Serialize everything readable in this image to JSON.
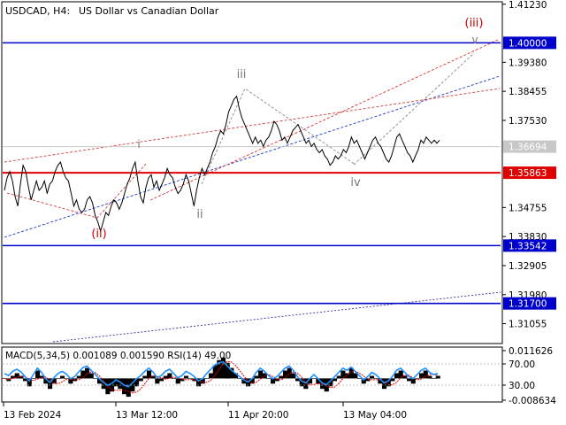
{
  "header": {
    "symbol": "USDCAD, H4:",
    "description": "US Dollar vs Canadian Dollar"
  },
  "chart_data": {
    "type": "line",
    "title": "USDCAD, H4:  US Dollar vs Canadian Dollar",
    "xlabel": "",
    "ylabel": "",
    "ylim": [
      1.3045,
      1.4128
    ],
    "grid": false,
    "price_ticks": [
      "1.41230",
      "1.39380",
      "1.38455",
      "1.37530",
      "1.34755",
      "1.33830",
      "1.32905",
      "1.31980",
      "1.31055"
    ],
    "x_ticks": [
      "13 Feb 2024",
      "13 Mar 12:00",
      "11 Apr 20:00",
      "13 May 04:00"
    ],
    "levels": [
      {
        "value": 1.4,
        "label": "1.40000",
        "color": "#0000cc"
      },
      {
        "value": 1.35863,
        "label": "1.35863",
        "color": "#e00000"
      },
      {
        "value": 1.33542,
        "label": "1.33542",
        "color": "#0000cc"
      },
      {
        "value": 1.317,
        "label": "1.31700",
        "color": "#0000cc"
      }
    ],
    "current_price": {
      "value": 1.36694,
      "label": "1.36694"
    },
    "price_series": {
      "name": "USDCAD",
      "values": [
        1.353,
        1.357,
        1.359,
        1.356,
        1.351,
        1.348,
        1.355,
        1.361,
        1.359,
        1.354,
        1.35,
        1.353,
        1.356,
        1.353,
        1.354,
        1.356,
        1.352,
        1.355,
        1.356,
        1.359,
        1.361,
        1.362,
        1.359,
        1.357,
        1.356,
        1.352,
        1.348,
        1.35,
        1.347,
        1.346,
        1.347,
        1.35,
        1.351,
        1.349,
        1.345,
        1.343,
        1.34,
        1.343,
        1.346,
        1.345,
        1.348,
        1.35,
        1.349,
        1.347,
        1.349,
        1.352,
        1.355,
        1.357,
        1.36,
        1.362,
        1.356,
        1.351,
        1.349,
        1.354,
        1.357,
        1.358,
        1.354,
        1.356,
        1.353,
        1.355,
        1.357,
        1.36,
        1.358,
        1.357,
        1.354,
        1.352,
        1.353,
        1.355,
        1.358,
        1.356,
        1.352,
        1.348,
        1.353,
        1.357,
        1.36,
        1.358,
        1.36,
        1.362,
        1.365,
        1.367,
        1.37,
        1.372,
        1.371,
        1.374,
        1.378,
        1.38,
        1.382,
        1.383,
        1.379,
        1.376,
        1.374,
        1.372,
        1.37,
        1.368,
        1.37,
        1.368,
        1.369,
        1.367,
        1.369,
        1.37,
        1.372,
        1.375,
        1.374,
        1.372,
        1.369,
        1.37,
        1.368,
        1.37,
        1.372,
        1.373,
        1.374,
        1.372,
        1.37,
        1.368,
        1.369,
        1.367,
        1.368,
        1.366,
        1.365,
        1.366,
        1.364,
        1.363,
        1.361,
        1.362,
        1.364,
        1.363,
        1.364,
        1.366,
        1.365,
        1.367,
        1.37,
        1.368,
        1.369,
        1.367,
        1.365,
        1.363,
        1.365,
        1.367,
        1.369,
        1.37,
        1.368,
        1.367,
        1.365,
        1.363,
        1.362,
        1.364,
        1.367,
        1.37,
        1.371,
        1.369,
        1.367,
        1.365,
        1.364,
        1.362,
        1.364,
        1.366,
        1.369,
        1.368,
        1.37,
        1.369,
        1.368,
        1.369,
        1.368,
        1.369
      ]
    },
    "waves": [
      {
        "label": "i",
        "color": "#777777"
      },
      {
        "label": "(ii)",
        "color": "#cc0000"
      },
      {
        "label": "ii",
        "color": "#777777"
      },
      {
        "label": "iii",
        "color": "#777777"
      },
      {
        "label": "iv",
        "color": "#777777"
      },
      {
        "label": "(iii)",
        "color": "#cc0000"
      },
      {
        "label": "v",
        "color": "#777777"
      }
    ],
    "indicator": {
      "label": "MACD(5,34,5) 0.001089 0.001590 RSI(14) 49.00",
      "ticks": [
        "0.011626",
        "70.00",
        "30.00",
        "-0.008634"
      ],
      "macd_values": [
        0.0,
        -0.001,
        0.001,
        0.002,
        0.001,
        -0.001,
        -0.003,
        0.0,
        0.003,
        0.001,
        -0.002,
        -0.004,
        -0.002,
        0.0,
        0.001,
        0.0,
        -0.002,
        -0.001,
        0.001,
        0.003,
        0.004,
        0.002,
        0.0,
        -0.002,
        -0.004,
        -0.006,
        -0.005,
        -0.003,
        -0.004,
        -0.006,
        -0.007,
        -0.005,
        -0.003,
        -0.001,
        0.001,
        0.003,
        0.001,
        -0.002,
        -0.001,
        0.001,
        0.002,
        0.0,
        -0.002,
        -0.001,
        0.001,
        0.0,
        -0.001,
        -0.003,
        -0.002,
        0.0,
        0.002,
        0.005,
        0.007,
        0.008,
        0.006,
        0.004,
        0.002,
        0.0,
        -0.002,
        -0.003,
        -0.002,
        0.001,
        0.003,
        0.002,
        0.0,
        -0.002,
        -0.001,
        0.001,
        0.003,
        0.004,
        0.002,
        -0.001,
        -0.003,
        -0.004,
        -0.002,
        0.0,
        -0.002,
        -0.004,
        -0.005,
        -0.003,
        -0.001,
        0.001,
        0.003,
        0.002,
        0.004,
        0.002,
        0.0,
        -0.002,
        -0.001,
        0.001,
        0.0,
        -0.002,
        -0.004,
        -0.003,
        -0.001,
        0.002,
        0.003,
        0.001,
        -0.001,
        -0.002,
        0.0,
        0.002,
        0.003,
        0.001,
        0.0,
        0.001
      ],
      "rsi_values": [
        52,
        48,
        56,
        60,
        55,
        46,
        38,
        50,
        62,
        54,
        42,
        35,
        44,
        52,
        56,
        51,
        42,
        46,
        55,
        63,
        66,
        58,
        50,
        42,
        35,
        30,
        33,
        40,
        36,
        30,
        27,
        34,
        42,
        48,
        56,
        62,
        55,
        44,
        48,
        56,
        60,
        52,
        44,
        48,
        56,
        52,
        46,
        38,
        42,
        52,
        60,
        68,
        72,
        74,
        66,
        58,
        52,
        46,
        40,
        36,
        42,
        54,
        62,
        56,
        48,
        42,
        46,
        54,
        62,
        66,
        58,
        46,
        38,
        34,
        42,
        50,
        42,
        34,
        31,
        38,
        46,
        54,
        62,
        58,
        64,
        56,
        48,
        40,
        46,
        54,
        50,
        42,
        34,
        38,
        46,
        58,
        62,
        54,
        46,
        42,
        50,
        58,
        62,
        54,
        50,
        52
      ]
    }
  }
}
